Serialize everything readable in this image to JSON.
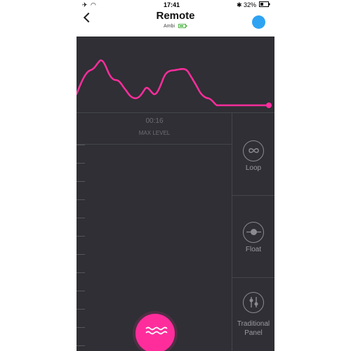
{
  "status_bar": {
    "time": "17:41",
    "battery": "32%"
  },
  "header": {
    "title": "Remote",
    "device_name": "Ambi"
  },
  "session": {
    "time": "00:16",
    "level_label": "MAX LEVEL"
  },
  "modes": [
    {
      "label": "Loop",
      "icon": "infinity-icon"
    },
    {
      "label": "Float",
      "icon": "float-icon"
    },
    {
      "label_line1": "Traditional",
      "label_line2": "Panel",
      "icon": "sliders-icon"
    }
  ],
  "colors": {
    "accent": "#ff2d9c",
    "panel": "#2f2f35",
    "connection": "#2ea3f2"
  }
}
